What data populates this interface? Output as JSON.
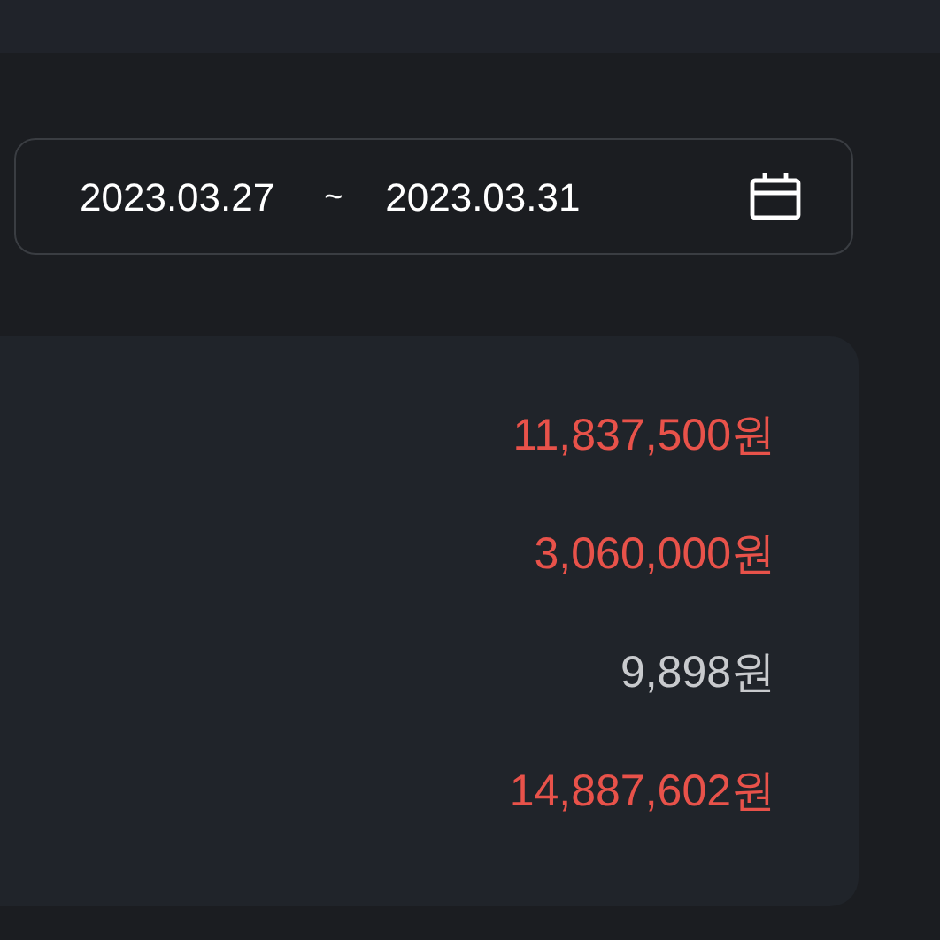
{
  "date_range": {
    "start": "2023.03.27",
    "separator": "~",
    "end": "2023.03.31"
  },
  "amounts": [
    {
      "text": "11,837,500원",
      "color": "#e8524a"
    },
    {
      "text": "3,060,000원",
      "color": "#e8524a"
    },
    {
      "text": "9,898원",
      "color": "#c8cacd"
    },
    {
      "text": "14,887,602원",
      "color": "#e8524a"
    }
  ]
}
